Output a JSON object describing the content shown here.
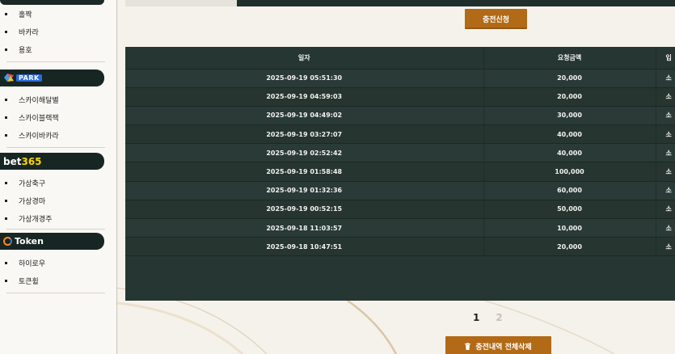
{
  "sidebar": {
    "group1": [
      "홀짝",
      "바카라",
      "용호"
    ],
    "skypark": {
      "logo_text": "PARK",
      "items": [
        "스카이해달별",
        "스카이블랙잭",
        "스카이바카라"
      ]
    },
    "bet365": {
      "logo_part1": "bet",
      "logo_part2": "365",
      "items": [
        "가상축구",
        "가상경마",
        "가상개경주"
      ]
    },
    "token": {
      "logo_text": "Token",
      "items": [
        "하이로우",
        "토큰휠"
      ]
    }
  },
  "main": {
    "charge_button": "충전신청",
    "table": {
      "headers": [
        "일자",
        "요청금액",
        "입"
      ],
      "rows": [
        [
          "2025-09-19 05:51:30",
          "20,000",
          "소"
        ],
        [
          "2025-09-19 04:59:03",
          "20,000",
          "소"
        ],
        [
          "2025-09-19 04:49:02",
          "30,000",
          "소"
        ],
        [
          "2025-09-19 03:27:07",
          "40,000",
          "소"
        ],
        [
          "2025-09-19 02:52:42",
          "40,000",
          "소"
        ],
        [
          "2025-09-19 01:58:48",
          "100,000",
          "소"
        ],
        [
          "2025-09-19 01:32:36",
          "60,000",
          "소"
        ],
        [
          "2025-09-19 00:52:15",
          "50,000",
          "소"
        ],
        [
          "2025-09-18 11:03:57",
          "10,000",
          "소"
        ],
        [
          "2025-09-18 10:47:51",
          "20,000",
          "소"
        ]
      ]
    },
    "pagination": {
      "pages": [
        "1",
        "2"
      ],
      "current": "1"
    },
    "delete_button": "충전내역 전체삭제"
  },
  "colors": {
    "accent_gold": "#b26a16",
    "table_dark": "#263632",
    "sidebar_brand_bar": "#172622",
    "bet365_yellow": "#ffd400"
  },
  "icons": [
    "trash-icon",
    "skypark-logo-icon",
    "token-logo-icon",
    "bullet-icon"
  ]
}
